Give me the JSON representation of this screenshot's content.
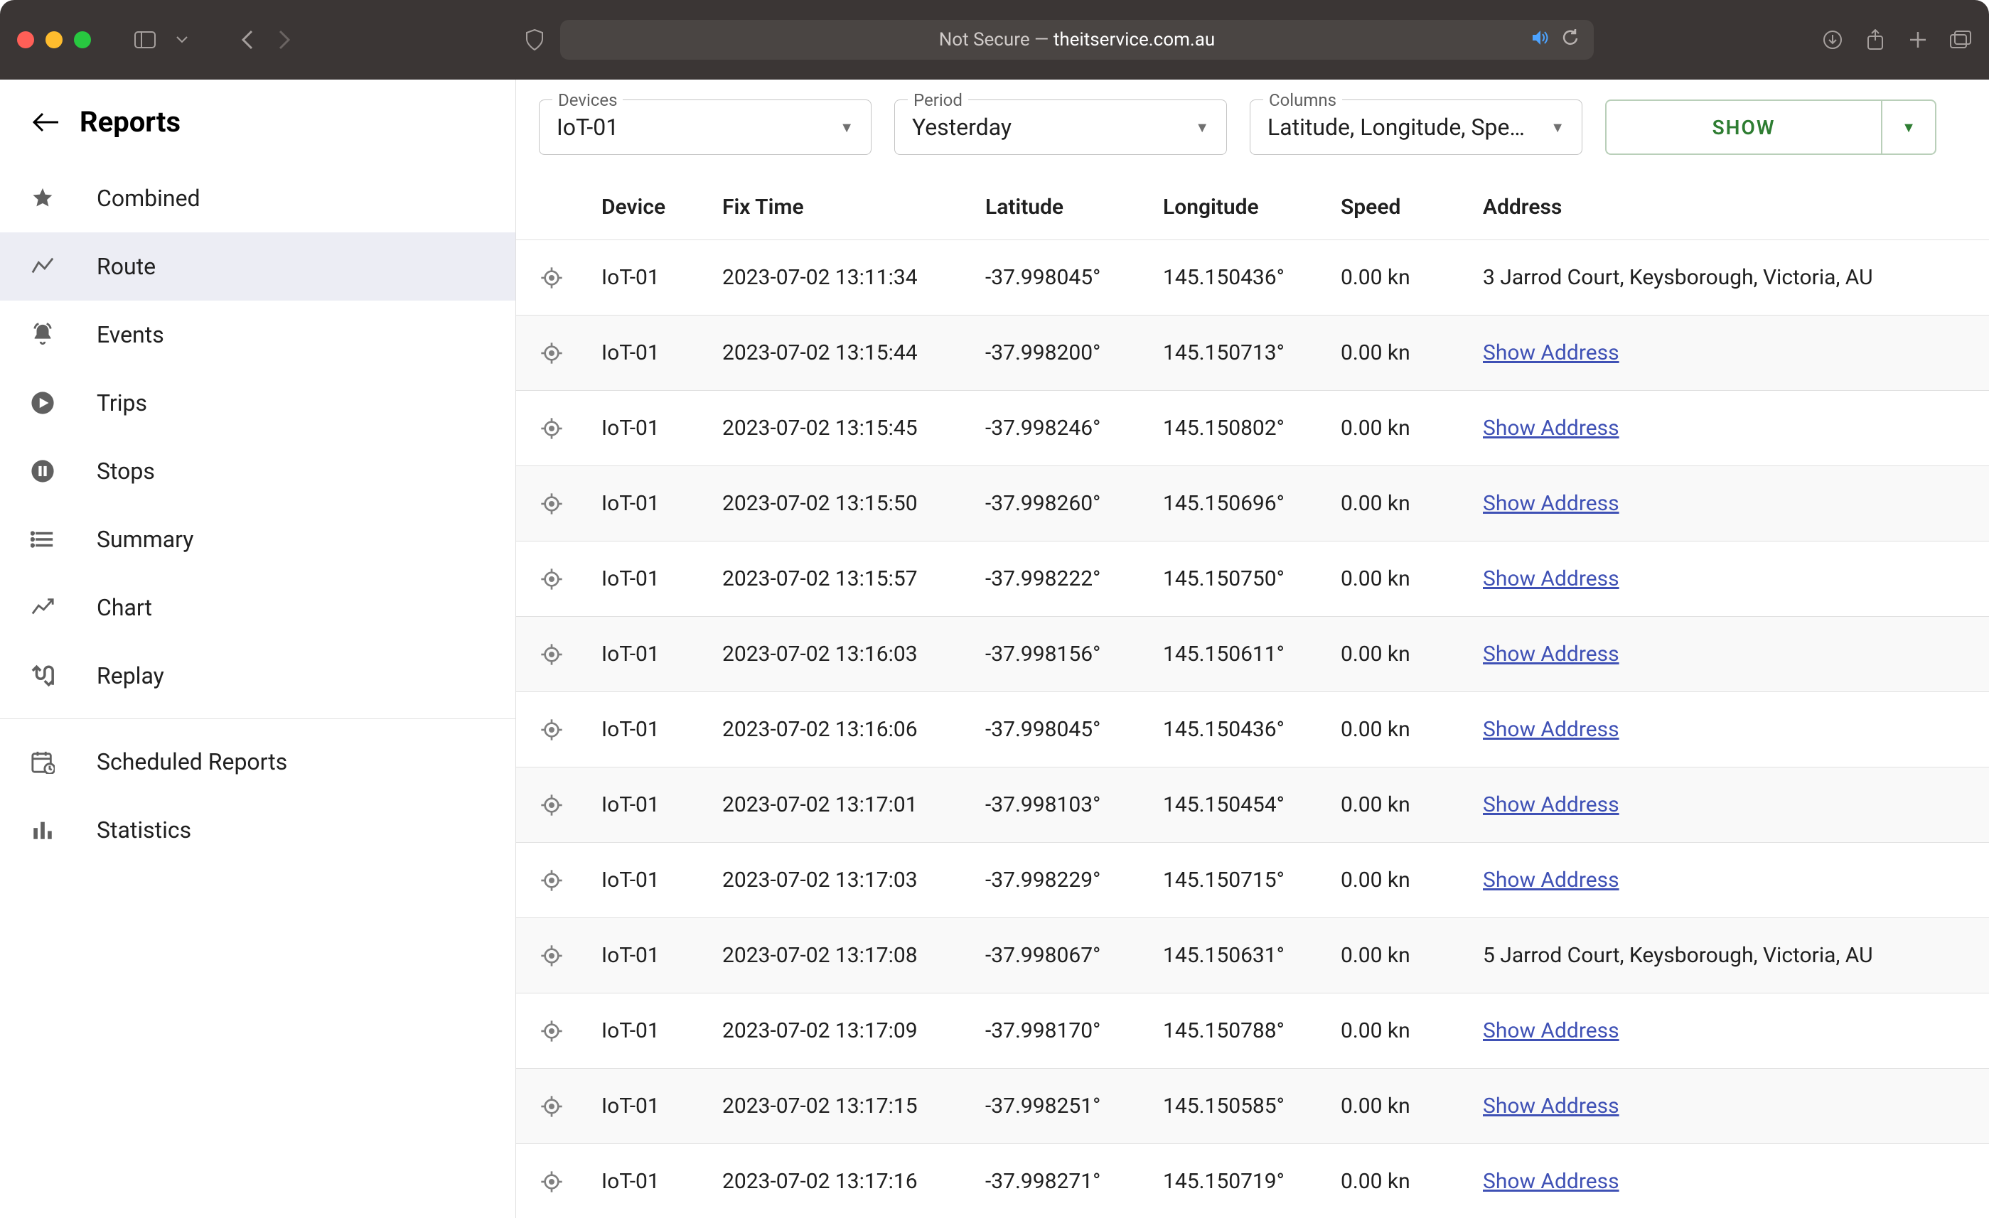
{
  "browser": {
    "not_secure_label": "Not Secure — ",
    "domain": "theitservice.com.au"
  },
  "sidebar": {
    "title": "Reports",
    "items": [
      {
        "label": "Combined",
        "icon": "star"
      },
      {
        "label": "Route",
        "icon": "timeline",
        "active": true
      },
      {
        "label": "Events",
        "icon": "bell"
      },
      {
        "label": "Trips",
        "icon": "play"
      },
      {
        "label": "Stops",
        "icon": "pause"
      },
      {
        "label": "Summary",
        "icon": "list"
      },
      {
        "label": "Chart",
        "icon": "chart"
      },
      {
        "label": "Replay",
        "icon": "replay"
      }
    ],
    "extra": [
      {
        "label": "Scheduled Reports",
        "icon": "calendar"
      },
      {
        "label": "Statistics",
        "icon": "bars"
      }
    ]
  },
  "filters": {
    "devices": {
      "legend": "Devices",
      "value": "IoT-01"
    },
    "period": {
      "legend": "Period",
      "value": "Yesterday"
    },
    "columns": {
      "legend": "Columns",
      "value": "Latitude, Longitude, Spe…"
    },
    "show_label": "SHOW"
  },
  "table": {
    "headers": {
      "device": "Device",
      "fix_time": "Fix Time",
      "latitude": "Latitude",
      "longitude": "Longitude",
      "speed": "Speed",
      "address": "Address"
    },
    "show_address_label": "Show Address",
    "rows": [
      {
        "device": "IoT-01",
        "fix": "2023-07-02 13:11:34",
        "lat": "-37.998045°",
        "lon": "145.150436°",
        "speed": "0.00 kn",
        "address": "3 Jarrod Court, Keysborough, Victoria, AU"
      },
      {
        "device": "IoT-01",
        "fix": "2023-07-02 13:15:44",
        "lat": "-37.998200°",
        "lon": "145.150713°",
        "speed": "0.00 kn",
        "address": null
      },
      {
        "device": "IoT-01",
        "fix": "2023-07-02 13:15:45",
        "lat": "-37.998246°",
        "lon": "145.150802°",
        "speed": "0.00 kn",
        "address": null
      },
      {
        "device": "IoT-01",
        "fix": "2023-07-02 13:15:50",
        "lat": "-37.998260°",
        "lon": "145.150696°",
        "speed": "0.00 kn",
        "address": null
      },
      {
        "device": "IoT-01",
        "fix": "2023-07-02 13:15:57",
        "lat": "-37.998222°",
        "lon": "145.150750°",
        "speed": "0.00 kn",
        "address": null
      },
      {
        "device": "IoT-01",
        "fix": "2023-07-02 13:16:03",
        "lat": "-37.998156°",
        "lon": "145.150611°",
        "speed": "0.00 kn",
        "address": null
      },
      {
        "device": "IoT-01",
        "fix": "2023-07-02 13:16:06",
        "lat": "-37.998045°",
        "lon": "145.150436°",
        "speed": "0.00 kn",
        "address": null
      },
      {
        "device": "IoT-01",
        "fix": "2023-07-02 13:17:01",
        "lat": "-37.998103°",
        "lon": "145.150454°",
        "speed": "0.00 kn",
        "address": null
      },
      {
        "device": "IoT-01",
        "fix": "2023-07-02 13:17:03",
        "lat": "-37.998229°",
        "lon": "145.150715°",
        "speed": "0.00 kn",
        "address": null
      },
      {
        "device": "IoT-01",
        "fix": "2023-07-02 13:17:08",
        "lat": "-37.998067°",
        "lon": "145.150631°",
        "speed": "0.00 kn",
        "address": "5 Jarrod Court, Keysborough, Victoria, AU"
      },
      {
        "device": "IoT-01",
        "fix": "2023-07-02 13:17:09",
        "lat": "-37.998170°",
        "lon": "145.150788°",
        "speed": "0.00 kn",
        "address": null
      },
      {
        "device": "IoT-01",
        "fix": "2023-07-02 13:17:15",
        "lat": "-37.998251°",
        "lon": "145.150585°",
        "speed": "0.00 kn",
        "address": null
      },
      {
        "device": "IoT-01",
        "fix": "2023-07-02 13:17:16",
        "lat": "-37.998271°",
        "lon": "145.150719°",
        "speed": "0.00 kn",
        "address": null
      }
    ]
  }
}
